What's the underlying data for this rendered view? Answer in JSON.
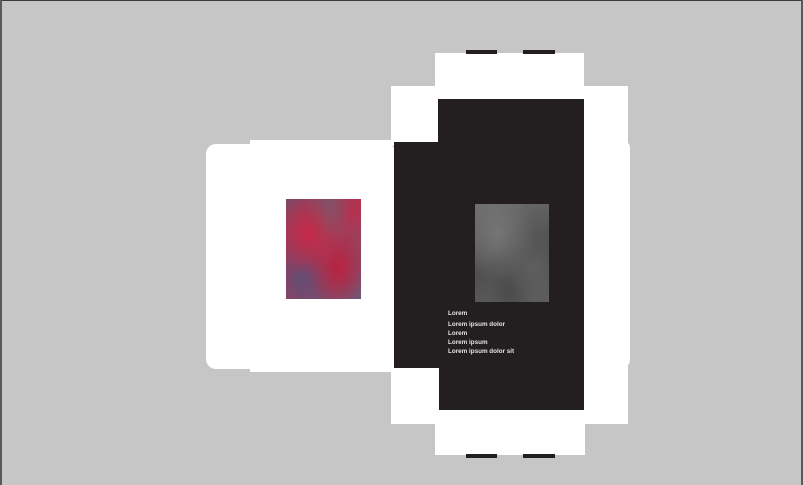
{
  "colors": {
    "pasteboard": "#c6c6c6",
    "artboard_white": "#ffffff",
    "panel_dark": "#231f20",
    "text_light": "#e4e4e4"
  },
  "artwork": {
    "front_image": "red-violet grunge texture",
    "back_image": "gray grunge texture"
  },
  "back_panel": {
    "lines": [
      "Lorem",
      "Lorem ipsum dolor",
      "Lorem",
      "Lorem ipsum",
      "Lorem ipsum dolor sit"
    ]
  }
}
